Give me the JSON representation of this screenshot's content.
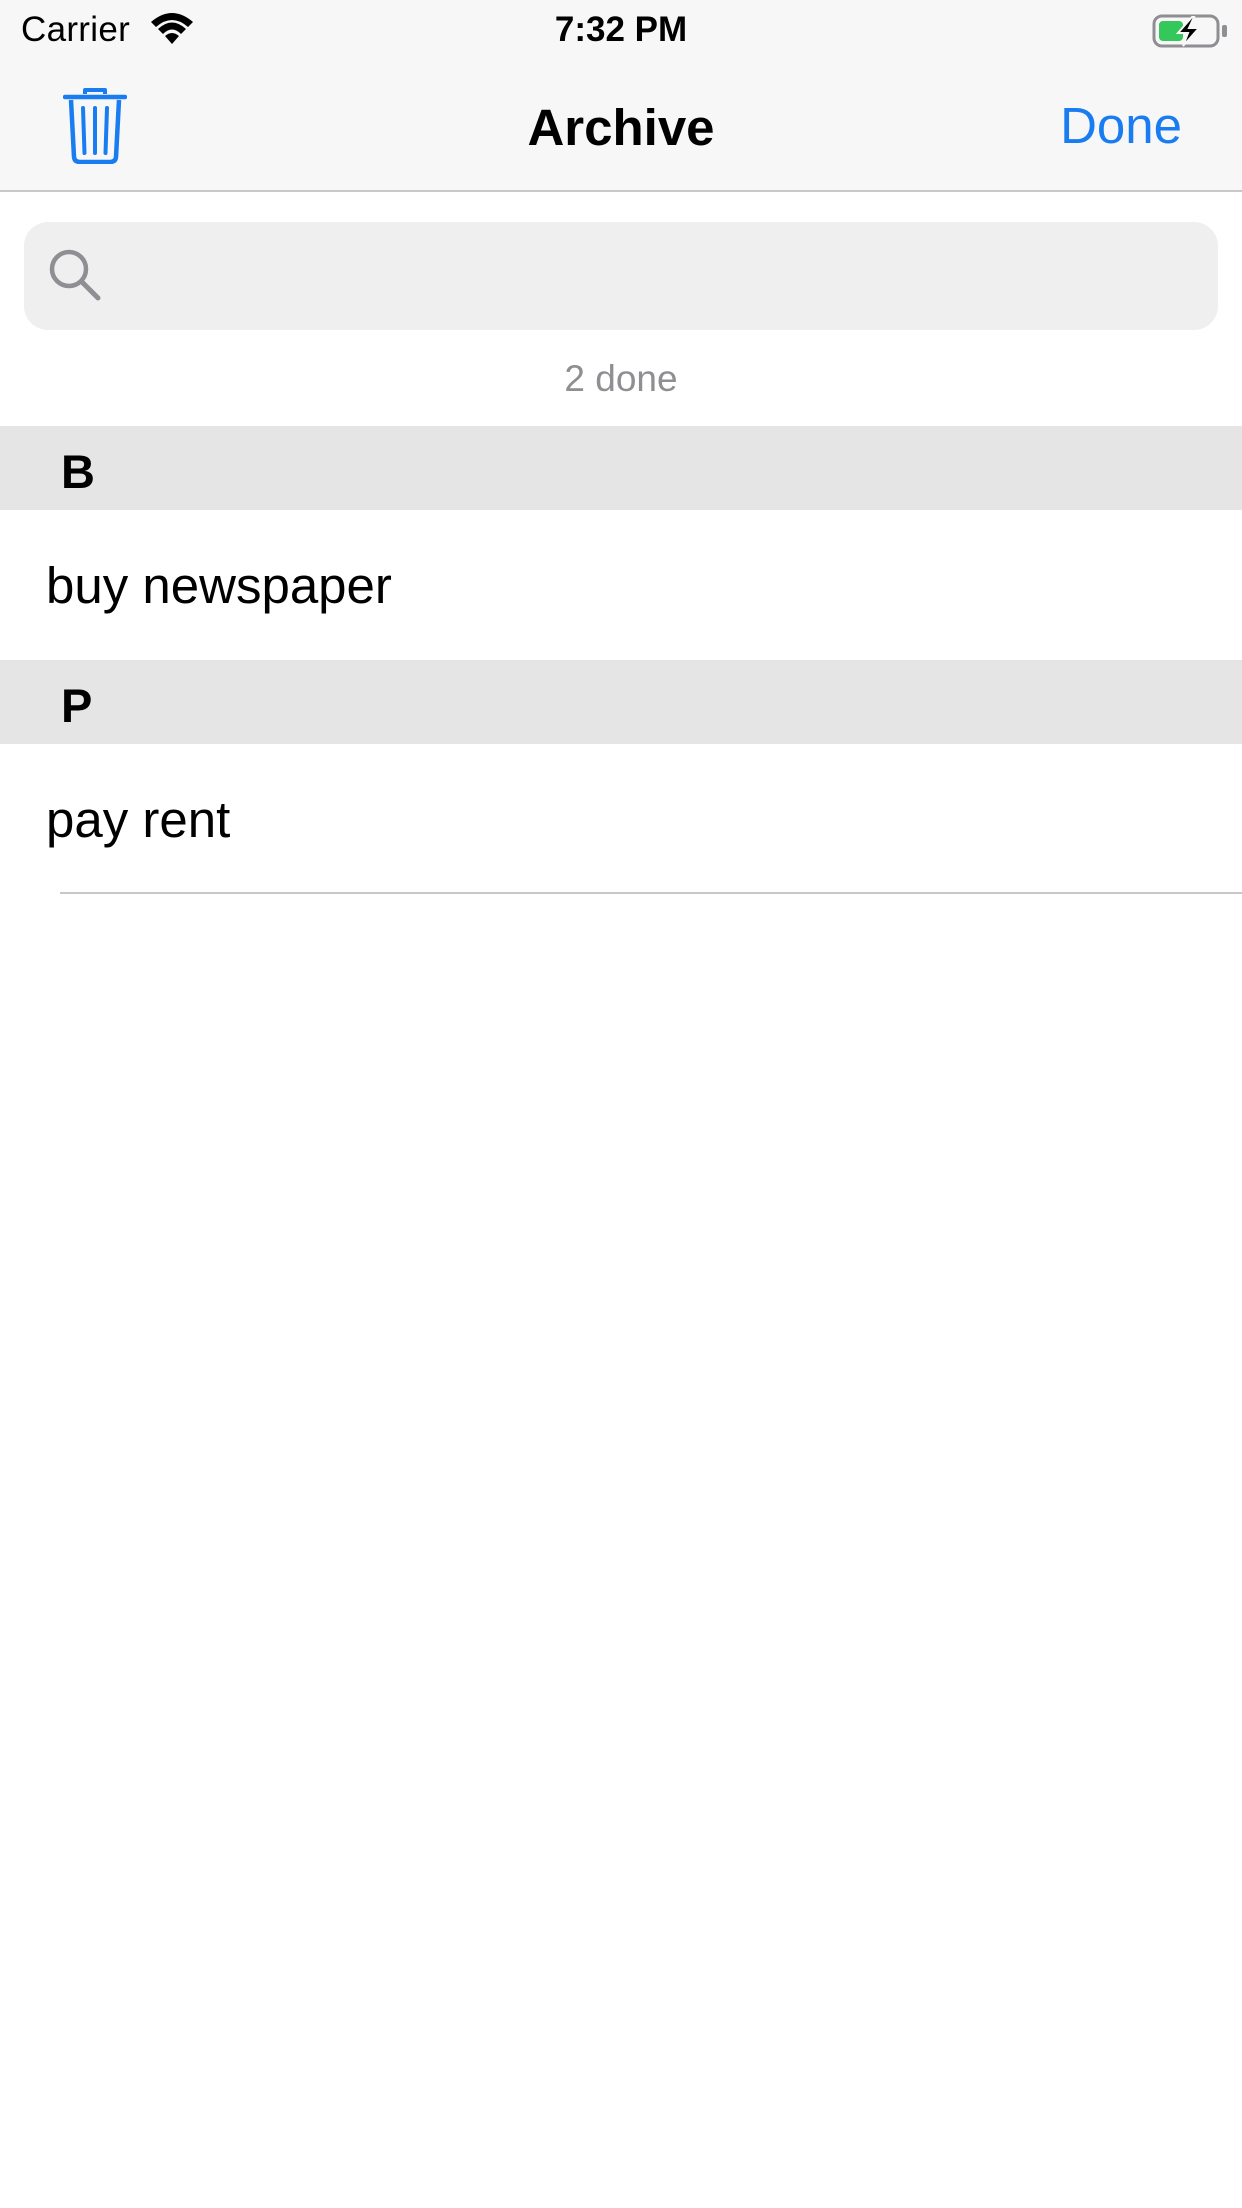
{
  "status_bar": {
    "carrier": "Carrier",
    "time": "7:32 PM",
    "wifi_icon": "wifi-icon",
    "battery_icon": "battery-charging-icon",
    "battery_color": "#34c759"
  },
  "nav_bar": {
    "title": "Archive",
    "left_icon": "trash-icon",
    "right_button_label": "Done",
    "accent_color": "#1a7cf1"
  },
  "search": {
    "icon": "search-icon",
    "value": "",
    "placeholder": ""
  },
  "count_label": "2 done",
  "sections": [
    {
      "letter": "B",
      "items": [
        "buy newspaper"
      ]
    },
    {
      "letter": "P",
      "items": [
        "pay rent"
      ]
    }
  ]
}
